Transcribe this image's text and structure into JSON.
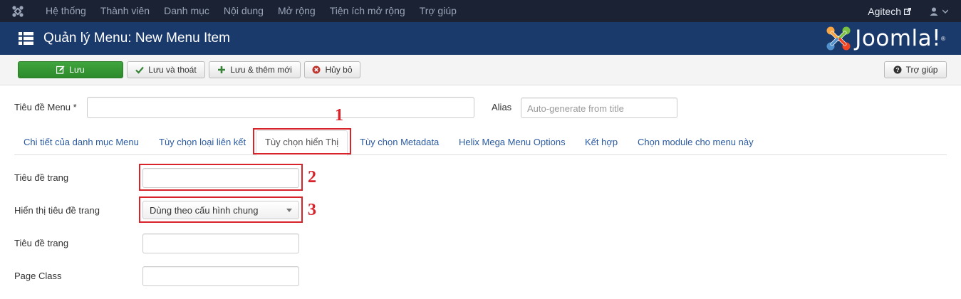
{
  "topnav": {
    "items": [
      "Hệ thống",
      "Thành viên",
      "Danh mục",
      "Nội dung",
      "Mở rộng",
      "Tiện ích mở rộng",
      "Trợ giúp"
    ],
    "site_name": "Agitech"
  },
  "header": {
    "title": "Quản lý Menu: New Menu Item",
    "brand": "Joomla!",
    "brand_mark": "®"
  },
  "toolbar": {
    "save": "Lưu",
    "save_close": "Lưu và thoát",
    "save_new": "Lưu & thêm mới",
    "cancel": "Hủy bỏ",
    "help": "Trợ giúp"
  },
  "form": {
    "menu_title_label": "Tiêu đề Menu *",
    "menu_title_value": "",
    "alias_label": "Alias",
    "alias_placeholder": "Auto-generate from title"
  },
  "tabs": [
    "Chi tiết của danh mục Menu",
    "Tùy chọn loại liên kết",
    "Tùy chọn hiển Thị",
    "Tùy chọn Metadata",
    "Helix Mega Menu Options",
    "Kết hợp",
    "Chọn module cho menu này"
  ],
  "active_tab": "Tùy chọn hiển Thị",
  "fields": {
    "browser_title_label": "Tiêu đề trang",
    "show_title_label": "Hiển thị tiêu đề trang",
    "show_title_value": "Dùng theo cấu hình chung",
    "page_heading_label": "Tiêu đề trang",
    "page_class_label": "Page Class"
  },
  "annotations": [
    "1",
    "2",
    "3"
  ],
  "colors": {
    "topnav_bg": "#1a2234",
    "header_bg": "#1b3a6c",
    "save_green": "#2d8a2b",
    "highlight_red": "#d9232b",
    "link_blue": "#2a5aa0"
  }
}
